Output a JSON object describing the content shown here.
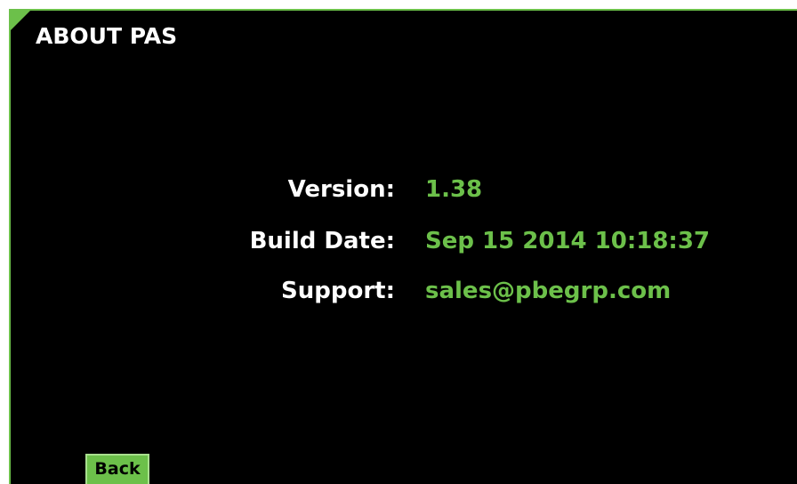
{
  "screen": {
    "title": "ABOUT PAS"
  },
  "info": {
    "version_label": "Version:",
    "version_value": "1.38",
    "build_date_label": "Build Date:",
    "build_date_value": "Sep 15 2014 10:18:37",
    "support_label": "Support:",
    "support_value": "sales@pbegrp.com"
  },
  "footer": {
    "back_label": "Back"
  },
  "colors": {
    "accent": "#6cc04a",
    "background": "#000000",
    "text": "#ffffff"
  }
}
